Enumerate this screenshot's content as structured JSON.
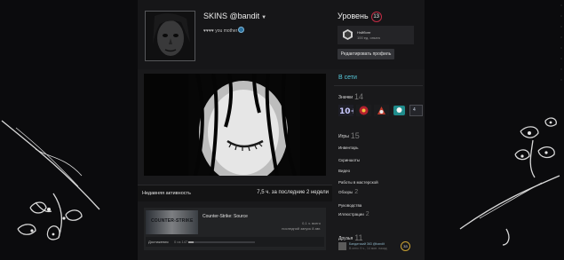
{
  "profile": {
    "username": "SKINS @bandit",
    "status": "♥♥♥♥ you mother"
  },
  "level": {
    "label": "Уровень",
    "value": "13"
  },
  "featured_badge": {
    "name": "Нэйбинг",
    "xp": "100 ед. опыта"
  },
  "edit_profile_label": "Редактировать профиль",
  "recent": {
    "title": "Недавняя активность",
    "summary": "7,5 ч. за последние 2 недели",
    "game": {
      "name": "Counter-Strike: Source",
      "capsule_text": "COUNTER-STRIKE",
      "hours": "0,1 ч. всего",
      "last_played": "последний запуск 8 авг.",
      "achievements_label": "Достижения",
      "achievements_progress": "0 из 147",
      "achievements_fraction": 0.0
    }
  },
  "sidebar": {
    "online": "В сети",
    "badges": {
      "label": "Значки",
      "count": "14",
      "more": "4"
    },
    "games": {
      "label": "Игры",
      "count": "15"
    },
    "links": [
      {
        "label": "Инвентарь",
        "count": ""
      },
      {
        "label": "Скриншоты",
        "count": ""
      },
      {
        "label": "Видео",
        "count": ""
      },
      {
        "label": "Работы в мастерской",
        "count": ""
      },
      {
        "label": "Обзоры",
        "count": "2"
      },
      {
        "label": "Руководства",
        "count": ""
      },
      {
        "label": "Иллюстрации",
        "count": "2"
      }
    ],
    "friends": {
      "label": "Друзья",
      "count": "11",
      "first_name": "Бандитский 363 @bandit",
      "first_status": "В сети: 9 ч., 14 мин. назад",
      "first_level": "33"
    }
  },
  "colors": {
    "page_bg": "#0b0b0d",
    "panel_bg": "#19191b",
    "online": "#57cbde",
    "level_ring": "#c22c45"
  }
}
